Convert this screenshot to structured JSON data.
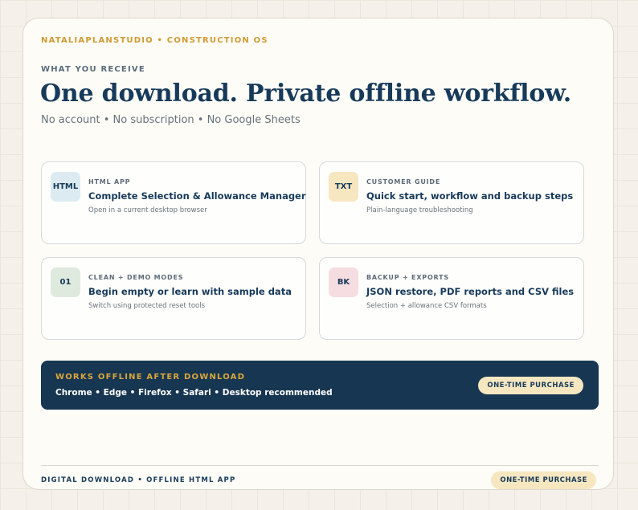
{
  "brand": "NATALIAPLANSTUDIO • CONSTRUCTION OS",
  "eyebrow": "WHAT YOU RECEIVE",
  "headline": "One download. Private offline workflow.",
  "subline": "No account • No subscription • No Google Sheets",
  "features": [
    {
      "badge": "HTML",
      "badge_color": "#dcebf1",
      "label": "HTML APP",
      "title": "Complete Selection & Allowance Manager",
      "description": "Open in a current desktop browser"
    },
    {
      "badge": "TXT",
      "badge_color": "#f6e7c1",
      "label": "CUSTOMER GUIDE",
      "title": "Quick start, workflow and backup steps",
      "description": "Plain-language troubleshooting"
    },
    {
      "badge": "01",
      "badge_color": "#dfeade",
      "label": "CLEAN + DEMO MODES",
      "title": "Begin empty or learn with sample data",
      "description": "Switch using protected reset tools"
    },
    {
      "badge": "BK",
      "badge_color": "#f6dde1",
      "label": "BACKUP + EXPORTS",
      "title": "JSON restore, PDF reports and CSV files",
      "description": "Selection + allowance CSV formats"
    }
  ],
  "banner": {
    "label": "WORKS OFFLINE AFTER DOWNLOAD",
    "text": "Chrome • Edge • Firefox • Safari • Desktop recommended",
    "pill": "ONE-TIME PURCHASE"
  },
  "footer": {
    "text": "DIGITAL DOWNLOAD • OFFLINE HTML APP",
    "pill": "ONE-TIME PURCHASE"
  }
}
